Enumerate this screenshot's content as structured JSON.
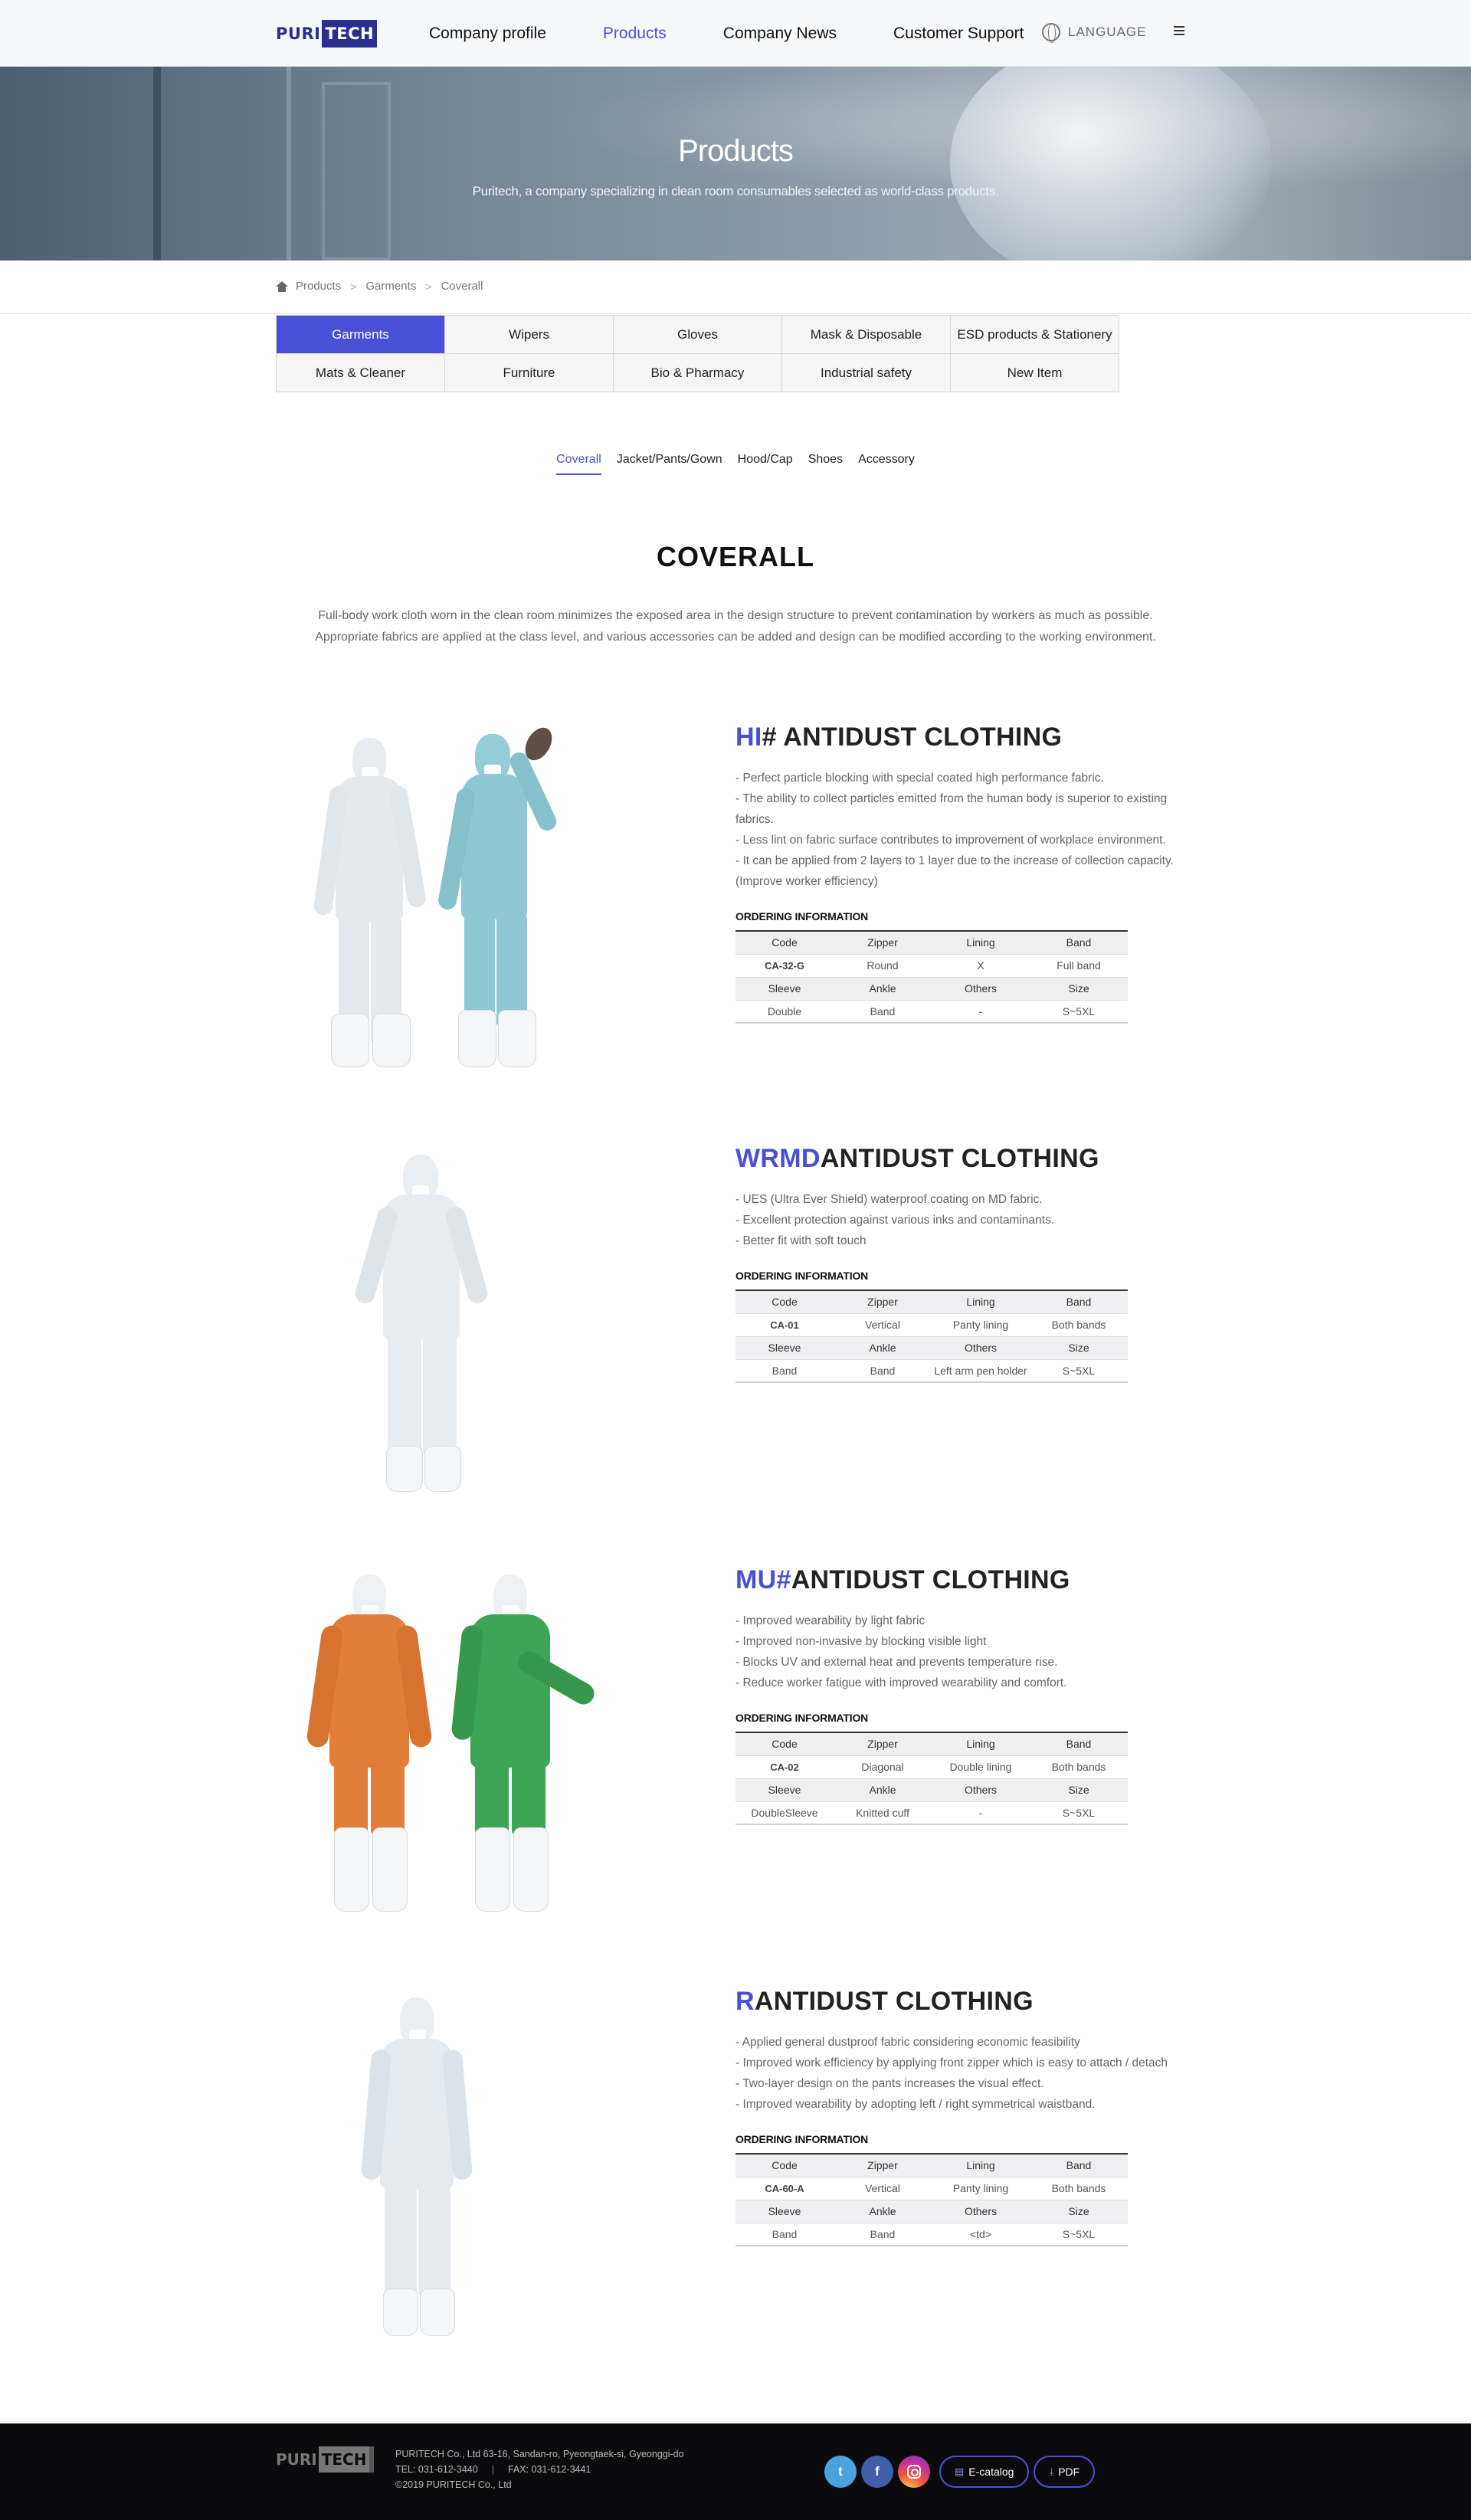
{
  "header": {
    "logo": {
      "part1": "PURI",
      "part2": "TECH"
    },
    "nav": [
      "Company profile",
      "Products",
      "Company News",
      "Customer Support"
    ],
    "active_nav": "Products",
    "language_label": "LANGUAGE"
  },
  "hero": {
    "title": "Products",
    "subtitle": "Puritech, a company specializing in clean room consumables selected as world-class products."
  },
  "breadcrumb": [
    "Products",
    "Garments",
    "Coverall"
  ],
  "categories": [
    "Garments",
    "Wipers",
    "Gloves",
    "Mask & Disposable",
    "ESD products & Stationery",
    "Mats & Cleaner",
    "Furniture",
    "Bio & Pharmacy",
    "Industrial safety",
    "New Item"
  ],
  "active_category": "Garments",
  "subtabs": [
    "Coverall",
    "Jacket/Pants/Gown",
    "Hood/Cap",
    "Shoes",
    "Accessory"
  ],
  "active_subtab": "Coverall",
  "section": {
    "title": "COVERALL",
    "desc_line1": "Full-body work cloth worn in the clean room minimizes the exposed area in the design structure to prevent contamination by workers as much as possible.",
    "desc_line2": "Appropriate fabrics are applied at the class level, and various accessories can be added and design can be modified according to the working environment."
  },
  "ordering_label": "ORDERING INFORMATION",
  "table_headers": {
    "row1": [
      "Code",
      "Zipper",
      "Lining",
      "Band"
    ],
    "row2": [
      "Sleeve",
      "Ankle",
      "Others",
      "Size"
    ]
  },
  "products": [
    {
      "name_highlight": "HI",
      "name_rest": "# ANTIDUST CLOTHING",
      "features": [
        "- Perfect particle blocking with special coated high performance fabric.",
        "- The ability to collect particles emitted from the human body is superior to existing fabrics.",
        "- Less lint on fabric surface contributes to improvement of workplace environment.",
        "- It can be applied from 2 layers to 1 layer due to the increase of collection capacity. (Improve worker efficiency)"
      ],
      "row1": [
        "CA-32-G",
        "Round",
        "X",
        "Full band"
      ],
      "row2": [
        "Double",
        "Band",
        "-",
        "S~5XL"
      ]
    },
    {
      "name_highlight": "WRMD",
      "name_rest": "ANTIDUST CLOTHING",
      "features": [
        "- UES (Ultra Ever Shield) waterproof coating on MD fabric.",
        "- Excellent protection against various inks and contaminants.",
        "- Better fit with soft touch"
      ],
      "row1": [
        "CA-01",
        "Vertical",
        "Panty lining",
        "Both bands"
      ],
      "row2": [
        "Band",
        "Band",
        "Left arm pen holder",
        "S~5XL"
      ]
    },
    {
      "name_highlight": "MU#",
      "name_rest": "ANTIDUST CLOTHING",
      "features": [
        "- Improved wearability by light fabric",
        "- Improved non-invasive by blocking visible light",
        "- Blocks UV and external heat and prevents temperature rise.",
        "- Reduce worker fatigue with improved wearability and comfort."
      ],
      "row1": [
        "CA-02",
        "Diagonal",
        "Double lining",
        "Both bands"
      ],
      "row2": [
        "DoubleSleeve",
        "Knitted cuff",
        "-",
        "S~5XL"
      ]
    },
    {
      "name_highlight": "R",
      "name_rest": "ANTIDUST CLOTHING",
      "features": [
        "- Applied general dustproof fabric considering economic feasibility",
        "- Improved work efficiency by applying front zipper which is easy to attach / detach",
        "- Two-layer design on the pants increases the visual effect.",
        "- Improved wearability by adopting left / right symmetrical waistband."
      ],
      "row1": [
        "CA-60-A",
        "Vertical",
        "Panty lining",
        "Both bands"
      ],
      "row2": [
        "Band",
        "Band",
        "<td>",
        "S~5XL"
      ]
    }
  ],
  "footer": {
    "logo": {
      "part1": "PURI",
      "part2": "TECH"
    },
    "address": "PURITECH Co., Ltd 63-16, Sandan-ro, Pyeongtaek-si, Gyeonggi-do",
    "tel": "TEL: 031-612-3440",
    "fax": "FAX: 031-612-3441",
    "copyright": "©2019 PURITECH Co., Ltd",
    "ecatalog_label": "E-catalog",
    "pdf_label": "PDF"
  },
  "colors": {
    "accent": "#4a4fd8",
    "footer_bg": "#0b0b0d",
    "coverall_white": "#e8eef3",
    "coverall_blue": "#8ec8d3",
    "coverall_orange": "#e27d3a",
    "coverall_green": "#3da556"
  },
  "icons": [
    "globe-icon",
    "menu-icon",
    "home-icon",
    "twitter-icon",
    "facebook-icon",
    "instagram-icon",
    "catalog-icon",
    "download-icon"
  ]
}
